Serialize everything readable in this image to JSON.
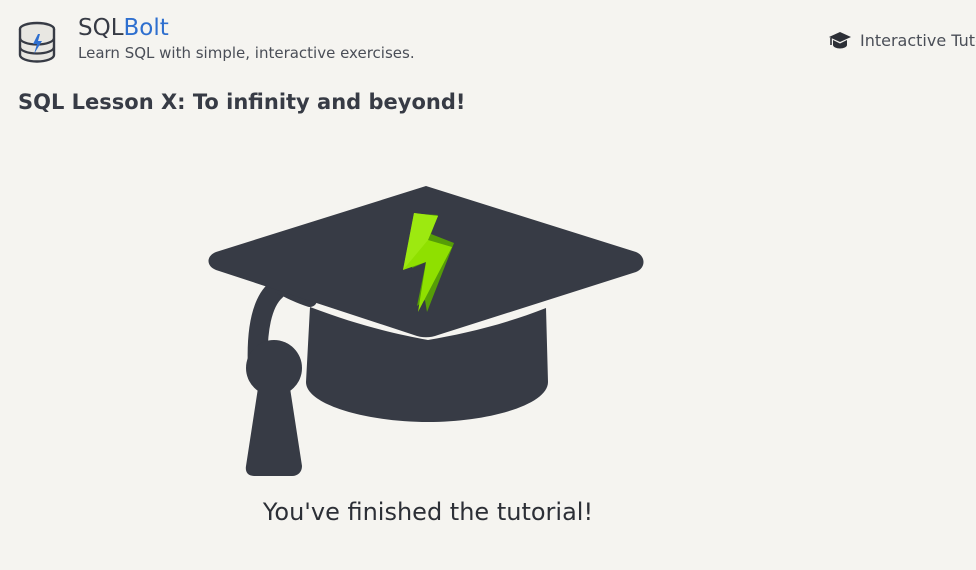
{
  "header": {
    "brand_prefix": "SQL",
    "brand_accent": "Bolt",
    "tagline": "Learn SQL with simple, interactive exercises.",
    "nav_link_label": "Interactive Tuto",
    "logo_icon": "database-bolt-icon",
    "nav_icon": "graduation-cap-icon"
  },
  "lesson": {
    "title": "SQL Lesson X: To infinity and beyond!"
  },
  "completion": {
    "illustration_icon": "graduation-cap-bolt-icon",
    "message": "You've finished the tutorial!"
  },
  "colors": {
    "background": "#f5f4f0",
    "text": "#373b45",
    "accent_blue": "#2e6fcf",
    "cap_dark": "#373b45",
    "bolt_green": "#8fe000"
  }
}
